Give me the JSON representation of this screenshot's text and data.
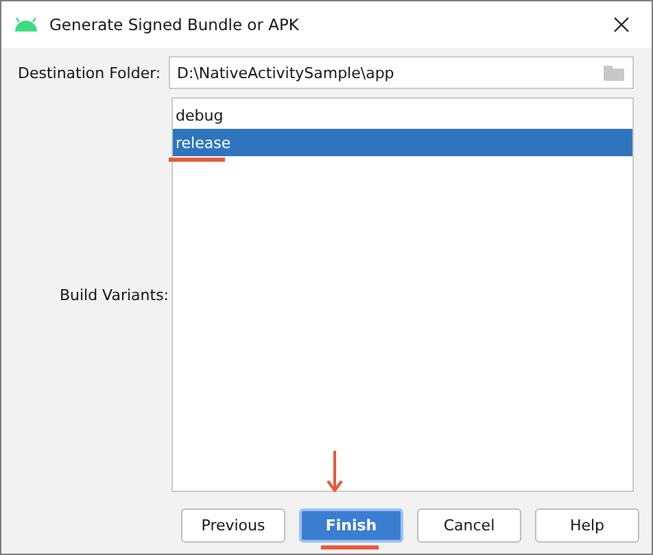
{
  "window": {
    "title": "Generate Signed Bundle or APK"
  },
  "destination": {
    "label": "Destination Folder:",
    "value": "D:\\NativeActivitySample\\app"
  },
  "build_variants": {
    "label": "Build Variants:",
    "items": [
      {
        "label": "debug",
        "selected": false
      },
      {
        "label": "release",
        "selected": true
      }
    ]
  },
  "buttons": [
    {
      "label": "Previous",
      "default": false
    },
    {
      "label": "Finish",
      "default": true
    },
    {
      "label": "Cancel",
      "default": false
    },
    {
      "label": "Help",
      "default": false
    }
  ]
}
